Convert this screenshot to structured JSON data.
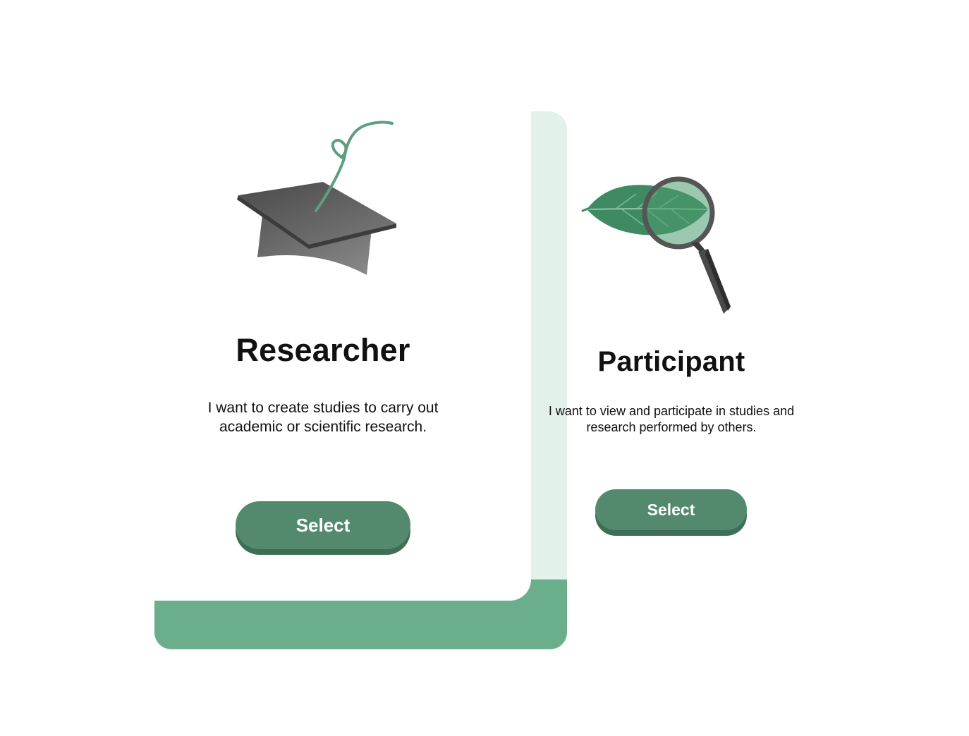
{
  "roles": {
    "researcher": {
      "title": "Researcher",
      "description": "I want to create studies to carry out academic or scientific research.",
      "button_label": "Select",
      "icon": "graduation-cap-icon"
    },
    "participant": {
      "title": "Participant",
      "description": "I want to view and participate in studies and research performed by others.",
      "button_label": "Select",
      "icon": "leaf-magnifier-icon"
    }
  },
  "colors": {
    "accent": "#538a6e",
    "accent_light": "#6bae8c",
    "accent_pale": "#e2f1ea",
    "text": "#111111"
  }
}
